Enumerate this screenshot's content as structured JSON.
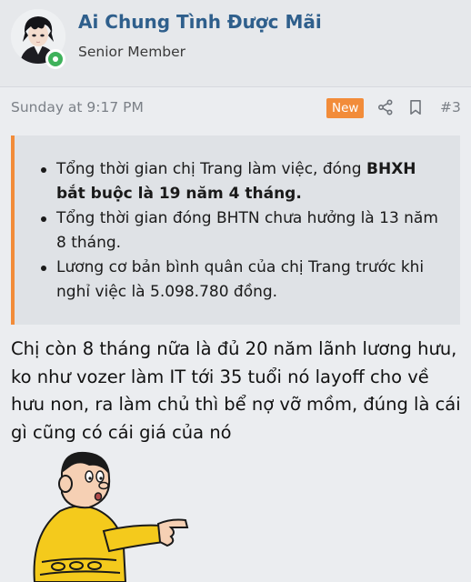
{
  "user": {
    "name": "Ai Chung Tình Được Mãi",
    "title": "Senior Member",
    "avatar_icon": "anime-boy-avatar",
    "online_color": "#3fb25b"
  },
  "post": {
    "time": "Sunday at 9:17 PM",
    "badge": "New",
    "number": "#3",
    "actions": [
      "share-icon",
      "bookmark-icon"
    ],
    "accent_color": "#f28c3a"
  },
  "quote": {
    "items": [
      {
        "pre": "Tổng thời gian chị Trang làm việc, đóng ",
        "bold": "BHXH bắt buộc là 19 năm 4 tháng.",
        "post": ""
      },
      {
        "pre": "Tổng thời gian đóng BHTN chưa hưởng là 13 năm 8 tháng.",
        "bold": "",
        "post": ""
      },
      {
        "pre": "Lương cơ bản bình quân của chị Trang trước khi nghỉ việc là 5.098.780 đồng.",
        "bold": "",
        "post": ""
      }
    ]
  },
  "body": {
    "text": "Chị còn 8 tháng nữa là đủ 20 năm lãnh lương hưu, ko như vozer làm IT tới 35 tuổi nó layoff cho về hưu non, ra làm chủ thì bể nợ vỡ mồm, đúng là cái gì cũng có cái giá của nó"
  },
  "sticker": {
    "icon": "pointing-cartoon-sticker"
  }
}
